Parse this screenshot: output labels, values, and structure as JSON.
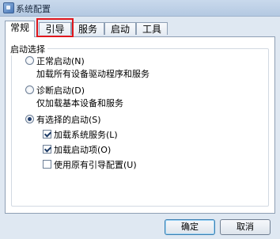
{
  "window": {
    "title": "系统配置"
  },
  "tabs": [
    {
      "label": "常规"
    },
    {
      "label": "引导"
    },
    {
      "label": "服务"
    },
    {
      "label": "启动"
    },
    {
      "label": "工具"
    }
  ],
  "startup_selection": {
    "group_title": "启动选择",
    "normal": {
      "label": "正常启动(N)",
      "description": "加载所有设备驱动程序和服务",
      "selected": false
    },
    "diagnostic": {
      "label": "诊断启动(D)",
      "description": "仅加载基本设备和服务",
      "selected": false
    },
    "selective": {
      "label": "有选择的启动(S)",
      "selected": true,
      "options": [
        {
          "label": "加载系统服务(L)",
          "checked": true
        },
        {
          "label": "加载启动项(O)",
          "checked": true
        },
        {
          "label": "使用原有引导配置(U)",
          "checked": false
        }
      ]
    }
  },
  "buttons": {
    "ok": "确定",
    "cancel": "取消"
  },
  "highlight_color": "#e0161c"
}
